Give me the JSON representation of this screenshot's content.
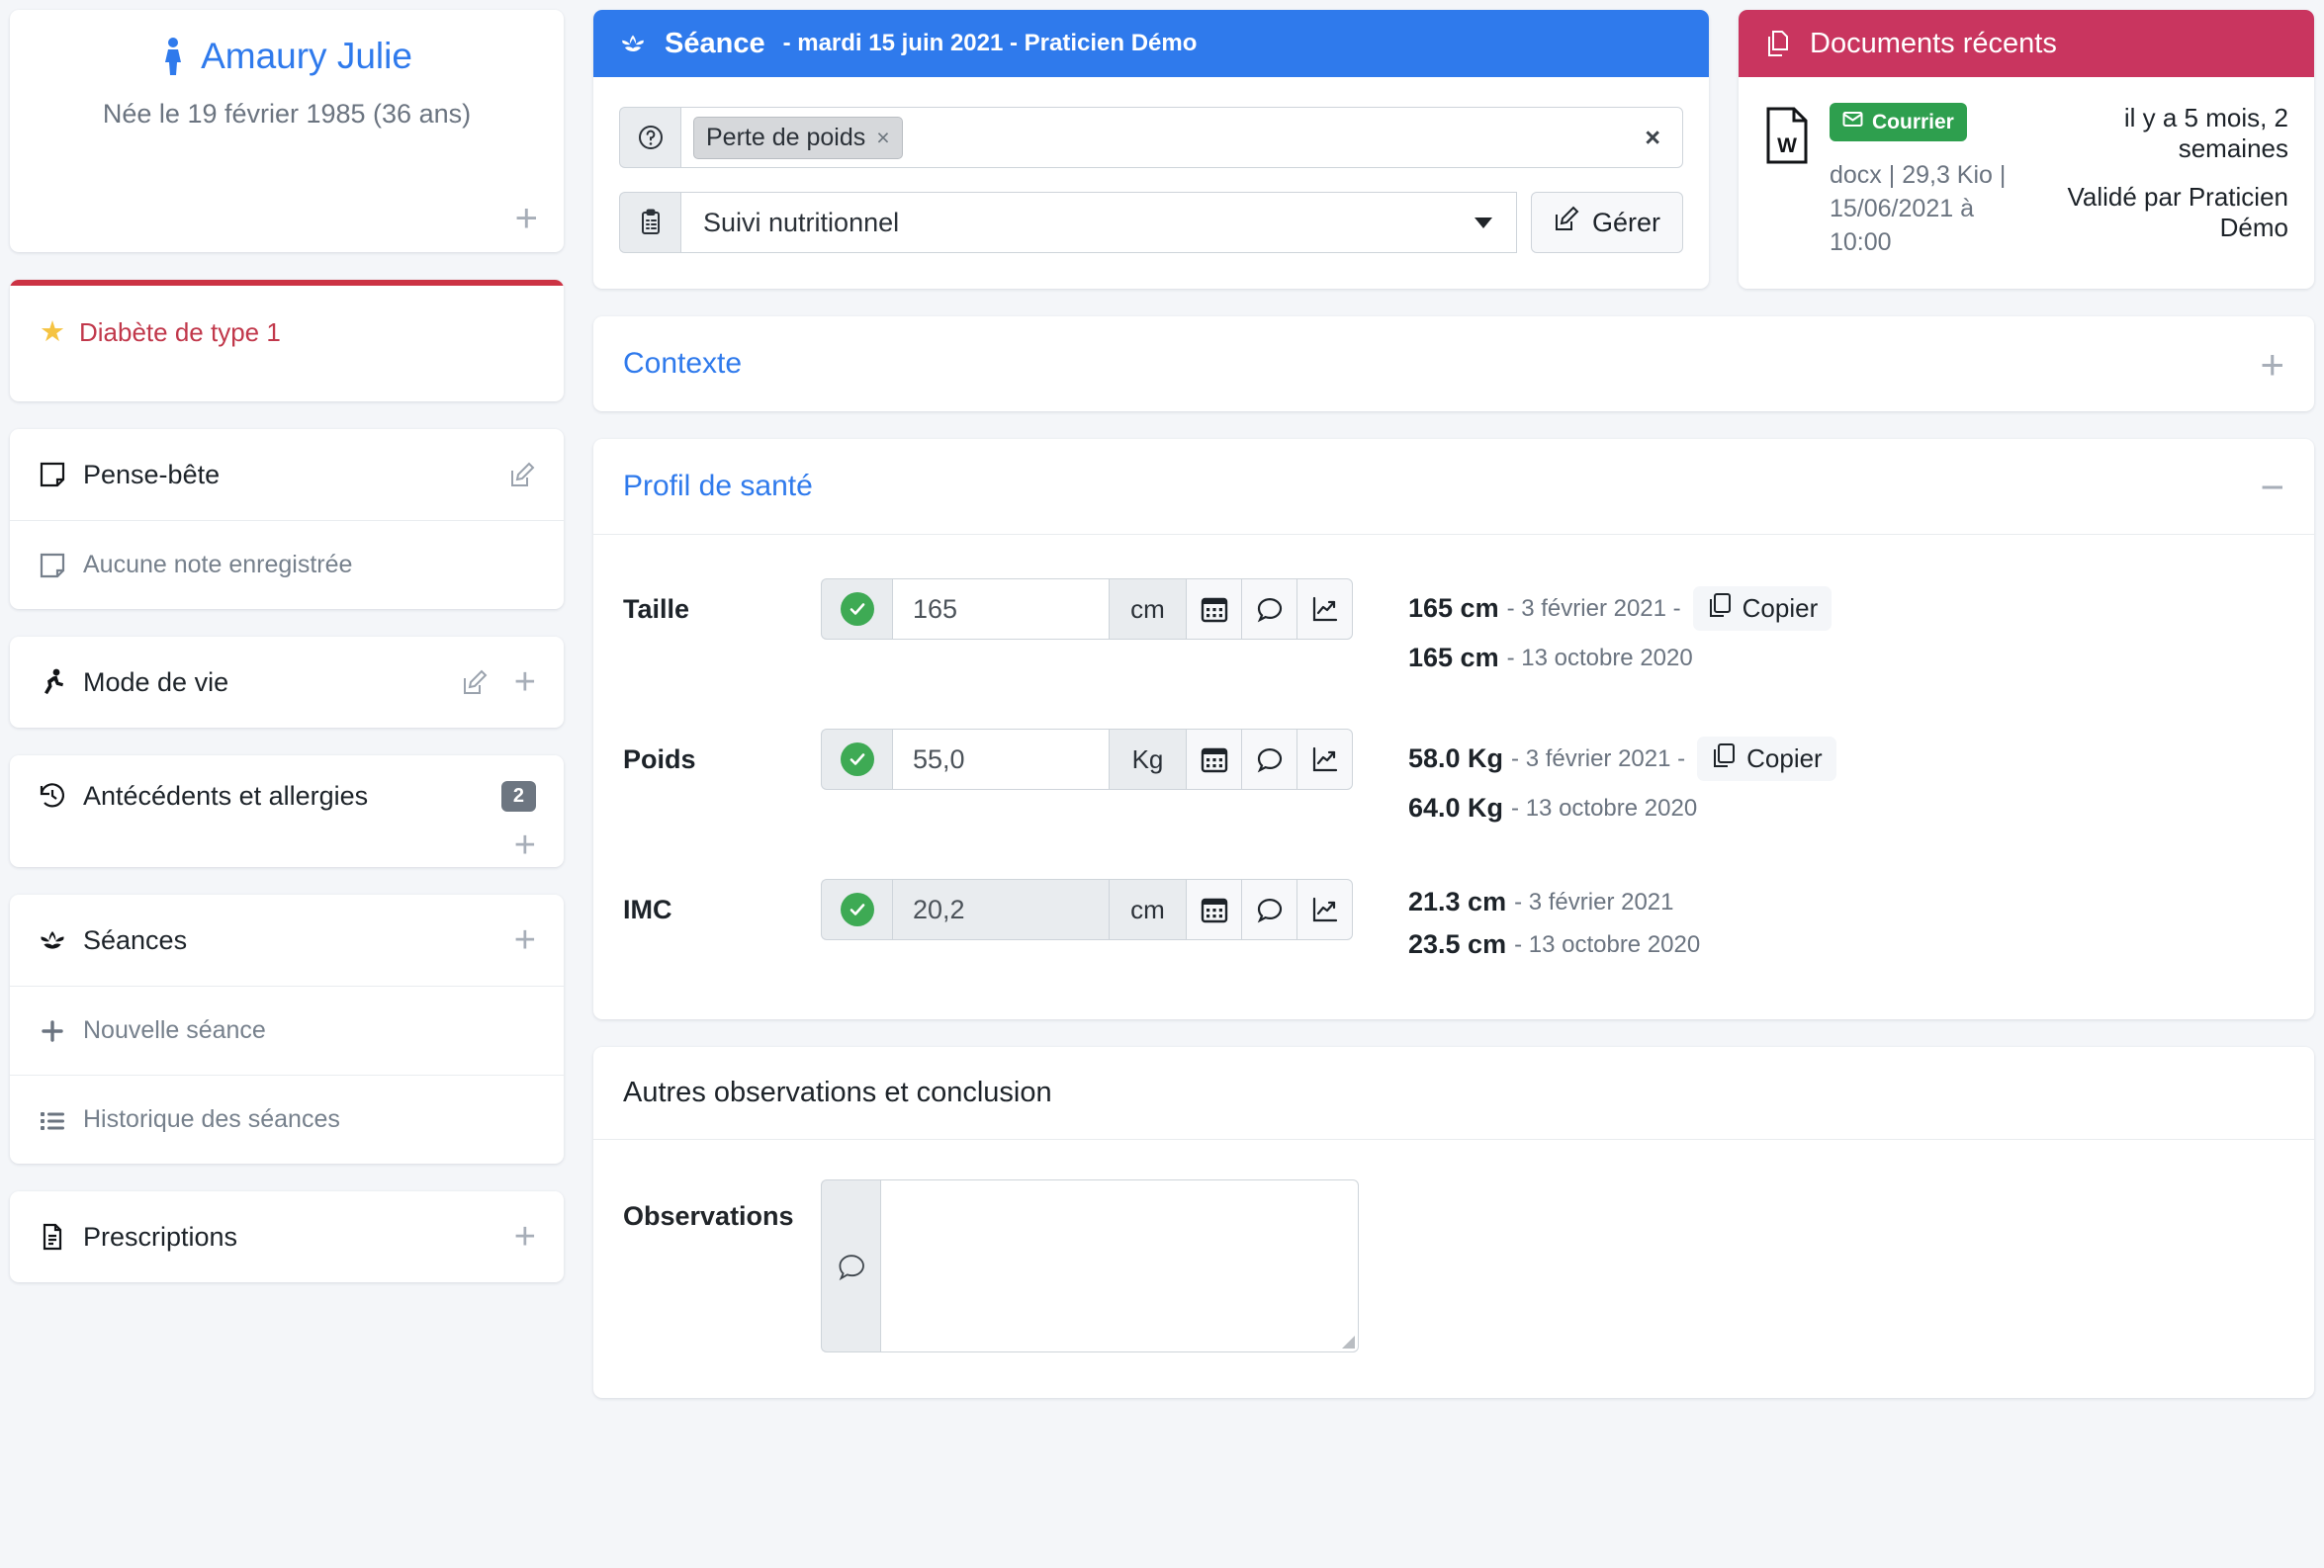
{
  "patient": {
    "name": "Amaury Julie",
    "birth": "Née le 19 février 1985 (36 ans)",
    "gender_icon": "female-figure-icon",
    "add_label": "+"
  },
  "alert": {
    "star_icon": "star-icon",
    "text": "Diabète de type 1",
    "accent": "#cc3344"
  },
  "sidebar": {
    "pense_bete": {
      "title": "Pense-bête",
      "icon": "sticky-note-icon",
      "edit_icon": "edit-square-icon",
      "empty_text": "Aucune note enregistrée",
      "empty_icon": "sticky-note-icon"
    },
    "mode_de_vie": {
      "title": "Mode de vie",
      "icon": "running-person-icon",
      "edit_icon": "edit-square-icon",
      "add_label": "+"
    },
    "antecedents": {
      "title": "Antécédents et allergies",
      "icon": "history-clock-icon",
      "count": "2",
      "add_label": "+"
    },
    "seances": {
      "title": "Séances",
      "icon": "lotus-icon",
      "add_label": "+",
      "items": [
        {
          "label": "Nouvelle séance",
          "icon": "plus-icon"
        },
        {
          "label": "Historique des séances",
          "icon": "list-icon"
        }
      ]
    },
    "prescriptions": {
      "title": "Prescriptions",
      "icon": "document-lines-icon",
      "add_label": "+"
    }
  },
  "seance": {
    "header_icon": "lotus-icon",
    "title": "Séance",
    "subtitle": "- mardi 15 juin 2021 - Praticien Démo",
    "header_color": "#2f7aec",
    "motive": {
      "addon_icon": "question-circle-icon",
      "tag": "Perte de poids",
      "tag_remove": "×",
      "clear": "×"
    },
    "protocol": {
      "addon_icon": "clipboard-list-icon",
      "selected": "Suivi nutritionnel",
      "manage_label": "Gérer",
      "manage_icon": "edit-square-icon"
    }
  },
  "documents": {
    "header_icon": "copy-documents-icon",
    "title": "Documents récents",
    "header_color": "#c9355f",
    "item": {
      "file_icon": "word-file-icon",
      "badge": "Courrier",
      "badge_icon": "envelope-icon",
      "badge_color": "#2e9f4e",
      "meta": "docx | 29,3 Kio |",
      "meta2": "15/06/2021 à 10:00",
      "age": "il y a 5 mois, 2 semaines",
      "validated": "Validé par Praticien Démo"
    }
  },
  "contexte": {
    "title": "Contexte",
    "toggle": "+"
  },
  "profil": {
    "title": "Profil de santé",
    "toggle": "−",
    "copier_label": "Copier",
    "copier_icon": "copy-icon",
    "rows": [
      {
        "label": "Taille",
        "value": "165",
        "unit": "cm",
        "readonly": false,
        "status_icon": "check-circle-icon",
        "buttons": [
          "calendar-icon",
          "comment-icon",
          "chart-line-icon"
        ],
        "history": [
          {
            "value": "165 cm",
            "date": "- 3 février 2021 -",
            "copier": true
          },
          {
            "value": "165 cm",
            "date": "- 13 octobre 2020",
            "copier": false
          }
        ]
      },
      {
        "label": "Poids",
        "value": "55,0",
        "unit": "Kg",
        "readonly": false,
        "status_icon": "check-circle-icon",
        "buttons": [
          "calendar-icon",
          "comment-icon",
          "chart-line-icon"
        ],
        "history": [
          {
            "value": "58.0 Kg",
            "date": "- 3 février 2021 -",
            "copier": true
          },
          {
            "value": "64.0 Kg",
            "date": "- 13 octobre 2020",
            "copier": false
          }
        ]
      },
      {
        "label": "IMC",
        "value": "20,2",
        "unit": "cm",
        "readonly": true,
        "status_icon": "check-circle-icon",
        "buttons": [
          "calendar-icon",
          "comment-icon",
          "chart-line-icon"
        ],
        "history": [
          {
            "value": "21.3 cm",
            "date": "- 3 février 2021",
            "copier": false
          },
          {
            "value": "23.5 cm",
            "date": "- 13 octobre 2020",
            "copier": false
          }
        ]
      }
    ]
  },
  "observations": {
    "title": "Autres observations et conclusion",
    "label": "Observations",
    "addon_icon": "comment-icon",
    "value": ""
  }
}
